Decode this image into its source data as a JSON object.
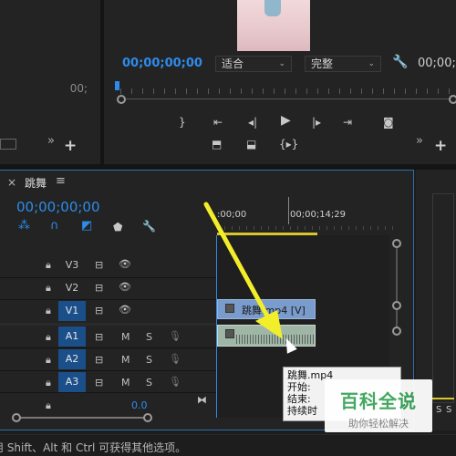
{
  "source_monitor": {
    "timecode": "00;",
    "plus_label": "+",
    "overflow_label": "»"
  },
  "program_monitor": {
    "timecode_left": "00;00;00;00",
    "fit_select": "适合",
    "quality_select": "完整",
    "timecode_right": "00;00;",
    "plus_label": "+",
    "overflow_label": "»"
  },
  "timeline": {
    "close_label": "×",
    "sequence_name": "跳舞",
    "menu_label": "≡",
    "playhead_timecode": "00;00;00;00",
    "ruler_labels": [
      ":00;00",
      "00;00;14;29"
    ],
    "tracks": [
      {
        "name": "V3",
        "active": false
      },
      {
        "name": "V2",
        "active": false
      },
      {
        "name": "V1",
        "active": true
      },
      {
        "name": "A1",
        "active": true
      },
      {
        "name": "A2",
        "active": true
      },
      {
        "name": "A3",
        "active": true
      }
    ],
    "audio_m_label": "M",
    "audio_s_label": "S",
    "mix_value": "0.0",
    "video_clip_label": "跳舞.mp4 [V]",
    "tooltip": {
      "line1": "跳舞.mp4",
      "line2": "开始:",
      "line3": "结束:",
      "line4": "持续时"
    }
  },
  "meter": {
    "s_label": "S",
    "s_label2": "S"
  },
  "watermark": {
    "title": "百科全说",
    "subtitle": "助你轻松解决"
  },
  "status_bar": {
    "text": "用 Shift、Alt 和 Ctrl 可获得其他选项。"
  },
  "colors": {
    "timecode_blue": "#2d8ceb",
    "active_track": "#1b4f8a",
    "clip_blue": "#7a9ccc",
    "arrow_yellow": "#f2ee2a",
    "watermark_green": "#3aa55a"
  }
}
